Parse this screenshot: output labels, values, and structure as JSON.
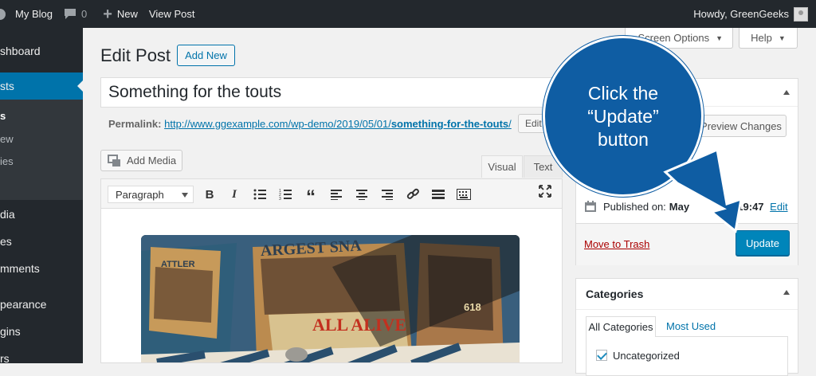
{
  "adminbar": {
    "site": "My Blog",
    "comments": "0",
    "new": "New",
    "view": "View Post",
    "howdy": "Howdy, GreenGeeks"
  },
  "sidebar": {
    "items": [
      "shboard",
      "sts",
      "dia",
      "es",
      "mments",
      "pearance",
      "gins",
      "rs"
    ],
    "subitems": [
      "s",
      "ew",
      "ies"
    ]
  },
  "page": {
    "title": "Edit Post",
    "add_new": "Add New"
  },
  "post": {
    "title": "Something for the touts",
    "permalink_label": "Permalink:",
    "permalink_url": "http://www.ggexample.com/wp-demo/2019/05/01/",
    "permalink_slug": "something-for-the-touts",
    "permalink_end": "/",
    "edit": "Edit"
  },
  "editor": {
    "add_media": "Add Media",
    "tab_visual": "Visual",
    "tab_text": "Text",
    "format": "Paragraph"
  },
  "screen_options": "Screen Options",
  "help": "Help",
  "publish": {
    "preview": "Preview Changes",
    "published_label": "Published on:",
    "published_date": "May",
    "published_time": "@ 19:47",
    "edit": "Edit",
    "edit2": "it",
    "trash": "Move to Trash",
    "update": "Update"
  },
  "callout": {
    "line1": "Click the",
    "line2": "“Update”",
    "line3": "button"
  },
  "categories": {
    "title": "Categories",
    "tab_all": "All Categories",
    "tab_used": "Most Used",
    "item": "Uncategorized"
  },
  "banner": {
    "top": "ARGEST SNA",
    "mid": "ALL ALIVE",
    "left": "ATTLER",
    "right": "618"
  },
  "colors": {
    "accent": "#0073aa",
    "callout": "#0f5da3",
    "adminbar": "#23282d"
  }
}
